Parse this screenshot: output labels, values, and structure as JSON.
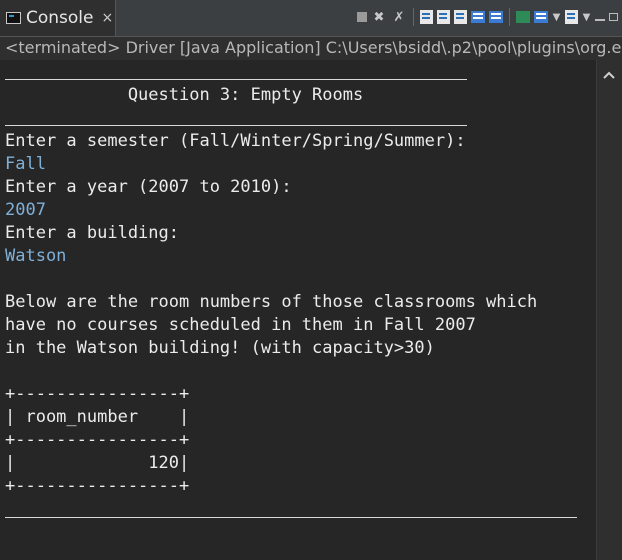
{
  "tab": {
    "label": "Console",
    "close": "×"
  },
  "status": "<terminated> Driver [Java Application] C:\\Users\\bsidd\\.p2\\pool\\plugins\\org.ec",
  "console": {
    "title": "            Question 3: Empty Rooms",
    "lines": [
      {
        "text": "Enter a semester (Fall/Winter/Spring/Summer):",
        "input": false
      },
      {
        "text": "Fall",
        "input": true
      },
      {
        "text": "Enter a year (2007 to 2010):",
        "input": false
      },
      {
        "text": "2007",
        "input": true
      },
      {
        "text": "Enter a building:",
        "input": false
      },
      {
        "text": "Watson",
        "input": true
      },
      {
        "text": "",
        "input": false
      },
      {
        "text": "Below are the room numbers of those classrooms which",
        "input": false
      },
      {
        "text": "have no courses scheduled in them in Fall 2007",
        "input": false
      },
      {
        "text": "in the Watson building! (with capacity>30)",
        "input": false
      },
      {
        "text": "",
        "input": false
      },
      {
        "text": "+----------------+",
        "input": false
      },
      {
        "text": "| room_number    |",
        "input": false
      },
      {
        "text": "+----------------+",
        "input": false
      },
      {
        "text": "|             120|",
        "input": false
      },
      {
        "text": "+----------------+",
        "input": false
      }
    ]
  },
  "colors": {
    "background": "#262626",
    "input_text": "#7fb0d8",
    "output_text": "#ebebeb"
  }
}
